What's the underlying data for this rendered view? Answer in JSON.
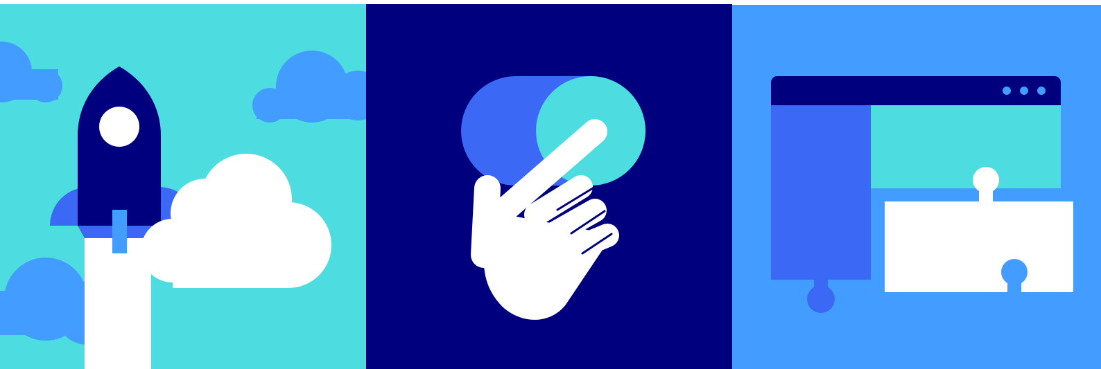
{
  "banner": {
    "panels": [
      {
        "name": "launch-panel",
        "icon": "rocket-icon",
        "background": "#4DDDE0"
      },
      {
        "name": "activate-panel",
        "icon": "toggle-switch-icon",
        "background": "#00007F"
      },
      {
        "name": "integrate-panel",
        "icon": "puzzle-browser-icon",
        "background": "#439CFF"
      }
    ],
    "colors": {
      "navy": "#00007F",
      "aqua": "#4DDDE0",
      "sky": "#439CFF",
      "royal": "#3B68F5",
      "white": "#FFFFFF"
    }
  }
}
